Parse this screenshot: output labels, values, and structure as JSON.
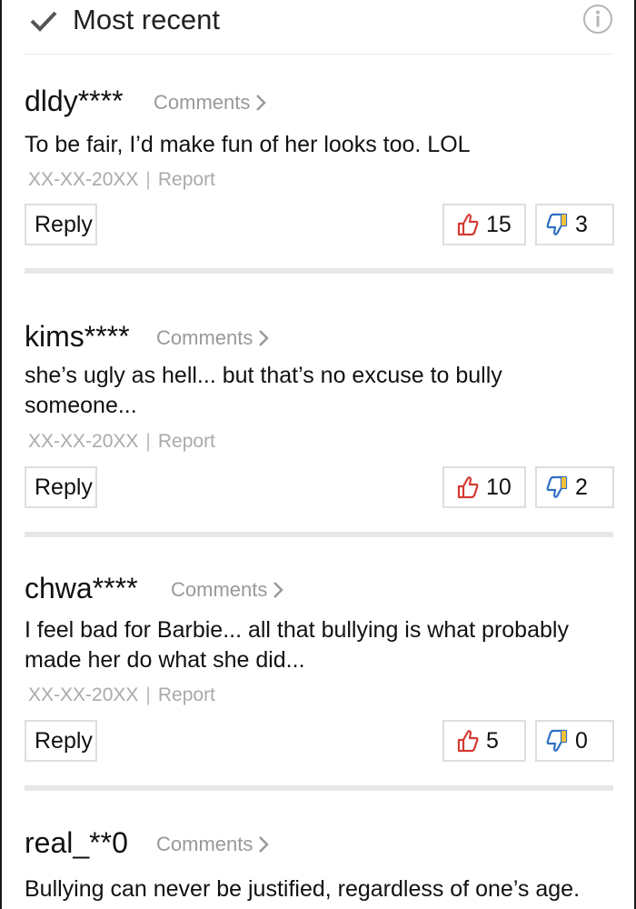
{
  "header": {
    "title": "Most recent"
  },
  "comments_link_label": "Comments",
  "report_label": "Report",
  "reply_label": "Reply",
  "comments": [
    {
      "user": "dldy****",
      "text": "To be fair, I’d make fun of her looks too. LOL",
      "date": "XX-XX-20XX",
      "likes": "15",
      "dislikes": "3"
    },
    {
      "user": "kims****",
      "text": "she’s ugly as hell... but that’s no excuse to bully someone...",
      "date": "XX-XX-20XX",
      "likes": "10",
      "dislikes": "2"
    },
    {
      "user": "chwa****",
      "text": "I feel bad for Barbie... all that bullying is what probably made her do what she did...",
      "date": "XX-XX-20XX",
      "likes": "5",
      "dislikes": "0"
    },
    {
      "user": "real_**0",
      "text": "Bullying can never be justified, regardless of one’s age.",
      "date": "",
      "likes": "",
      "dislikes": ""
    }
  ],
  "colors": {
    "thumb_up": "#d43b32",
    "thumb_down": "#2f6fc4",
    "muted": "#999999"
  },
  "icons": {
    "check": "check-icon",
    "info": "info-icon",
    "like": "thumbs-up-icon",
    "dislike": "thumbs-down-icon",
    "chevron": "chevron-right-icon"
  }
}
